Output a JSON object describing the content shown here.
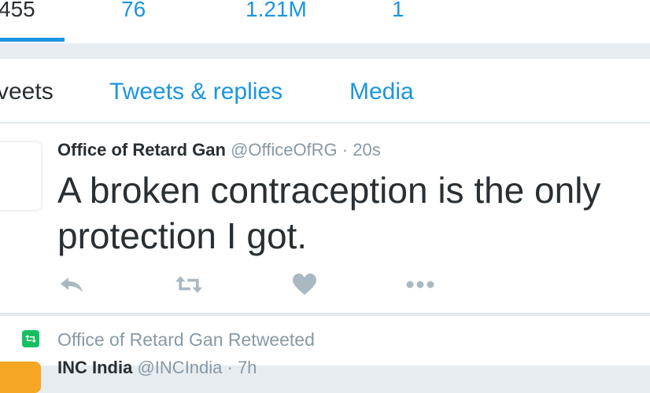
{
  "profile_stats": [
    {
      "value": "455",
      "active": true
    },
    {
      "value": "76",
      "active": false
    },
    {
      "value": "1.21M",
      "active": false
    },
    {
      "value": "1",
      "active": false
    }
  ],
  "tabs": [
    {
      "label": "veets",
      "current": true
    },
    {
      "label": "Tweets & replies",
      "current": false
    },
    {
      "label": "Media",
      "current": false
    }
  ],
  "tweet": {
    "author_name": "Office of Retard Gan",
    "author_handle": "@OfficeOfRG",
    "separator": "·",
    "time": "20s",
    "text": "A broken contraception is the only protection I got.",
    "actions": [
      {
        "icon": "reply-icon"
      },
      {
        "icon": "retweet-icon"
      },
      {
        "icon": "like-icon"
      },
      {
        "icon": "more-icon"
      }
    ]
  },
  "retweet_context": {
    "text": "Office of Retard Gan Retweeted",
    "icon": "retweet-badge-icon"
  },
  "next_tweet": {
    "author_partial": "INC India",
    "handle_partial": "@INCIndia · 7h"
  },
  "colors": {
    "link_blue": "#1b95e0",
    "text_dark": "#292f33",
    "text_gray": "#8899a6",
    "retweet_green": "#17bf63",
    "background": "#e6ecf0"
  }
}
